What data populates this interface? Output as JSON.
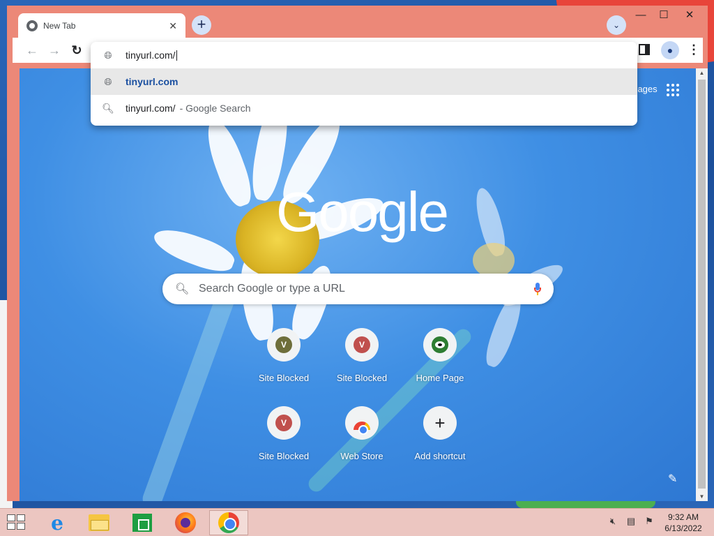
{
  "browser": {
    "tab": {
      "title": "New Tab",
      "close_glyph": "✕"
    },
    "new_tab_glyph": "+",
    "tab_search_glyph": "⌄",
    "window_controls": {
      "minimize": "—",
      "maximize": "☐",
      "close": "✕"
    },
    "toolbar": {
      "back_glyph": "←",
      "forward_glyph": "→",
      "reload_glyph": "↻",
      "menu_glyph": "⋮"
    }
  },
  "omnibox": {
    "input_value": "tinyurl.com/",
    "suggestions": [
      {
        "icon": "globe-icon",
        "text": "tinyurl.com",
        "bold": true
      },
      {
        "icon": "search-icon",
        "text": "tinyurl.com/",
        "suffix": "- Google Search"
      }
    ]
  },
  "new_tab_page": {
    "images_link": "Images",
    "logo": "Google",
    "search_placeholder": "Search Google or type a URL",
    "shortcuts": [
      {
        "label": "Site Blocked",
        "letter": "V",
        "color": "#6e6e3a"
      },
      {
        "label": "Site Blocked",
        "letter": "V",
        "color": "#c0504d"
      },
      {
        "label": "Home Page",
        "icon": "home-page-icon"
      },
      {
        "label": "Site Blocked",
        "letter": "V",
        "color": "#c0504d"
      },
      {
        "label": "Web Store",
        "icon": "web-store-icon"
      },
      {
        "label": "Add shortcut",
        "icon": "plus-icon"
      }
    ],
    "customize_glyph": "✎"
  },
  "taskbar": {
    "apps": [
      "start-icon",
      "internet-explorer-icon",
      "file-explorer-icon",
      "store-icon",
      "firefox-icon",
      "chrome-icon"
    ],
    "clock": {
      "time": "9:32 AM",
      "date": "6/13/2022"
    }
  },
  "colors": {
    "window_frame": "#ec8878",
    "taskbar": "#ecc6c1",
    "accent": "#1a4fa0"
  }
}
